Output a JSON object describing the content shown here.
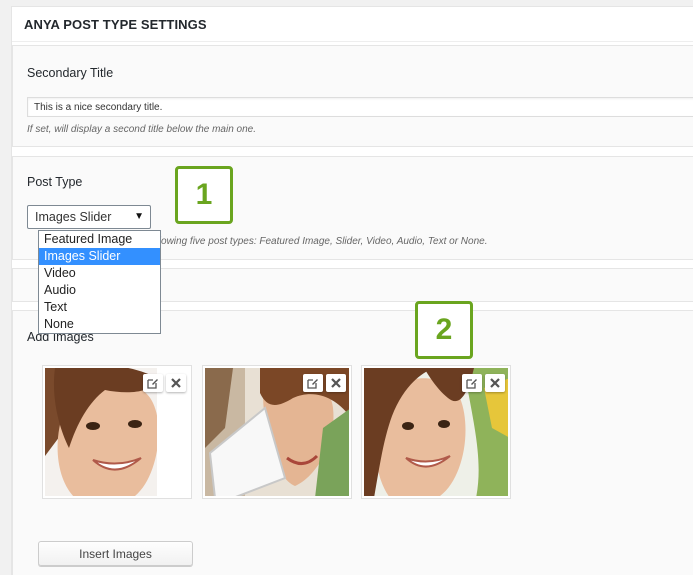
{
  "metabox": {
    "title": "ANYA POST TYPE SETTINGS"
  },
  "secondary_title": {
    "label": "Secondary Title",
    "value": "This is a nice secondary title.",
    "hint": "If set, will display a second title below the main one."
  },
  "post_type": {
    "label": "Post Type",
    "selected": "Images Slider",
    "options": [
      "Featured Image",
      "Images Slider",
      "Video",
      "Audio",
      "Text",
      "None"
    ],
    "hint_visible": "ollowing five post types: Featured Image, Slider, Video, Audio, Text or None."
  },
  "images": {
    "label": "Add Images",
    "count": 3,
    "insert_button": "Insert Images"
  },
  "annotations": {
    "badge_1": "1",
    "badge_2": "2"
  },
  "colors": {
    "badge_green": "#6aa51f",
    "selected_option": "#3390ff"
  }
}
